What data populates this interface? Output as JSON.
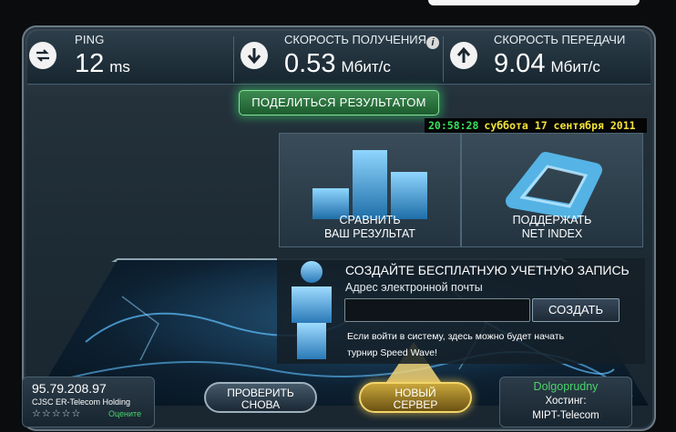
{
  "stats": {
    "ping": {
      "label": "PING",
      "value": "12",
      "unit": "ms"
    },
    "download": {
      "label": "СКОРОСТЬ ПОЛУЧЕНИЯ",
      "value": "0.53",
      "unit": "Мбит/с"
    },
    "upload": {
      "label": "СКОРОСТЬ ПЕРЕДАЧИ",
      "value": "9.04",
      "unit": "Мбит/с"
    }
  },
  "share_button": "ПОДЕЛИТЬСЯ РЕЗУЛЬТАТОМ",
  "clock": {
    "time": "20:58:28",
    "date": "суббота 17 сентября 2011"
  },
  "promos": [
    {
      "line1": "СРАВНИТЬ",
      "line2": "ВАШ РЕЗУЛЬТАТ"
    },
    {
      "line1": "ПОДДЕРЖАТЬ",
      "line2": "NET INDEX"
    }
  ],
  "signup": {
    "title": "СОЗДАЙТЕ БЕСПЛАТНУЮ УЧЕТНУЮ ЗАПИСЬ",
    "email_label": "Адрес электронной почты",
    "email_value": "",
    "create_button": "СОЗДАТЬ",
    "note_line1": "Если войти в систему, здесь можно будет начать",
    "note_line2": "турнир Speed Wave!"
  },
  "isp": {
    "ip": "95.79.208.97",
    "org": "CJSC ER-Telecom Holding",
    "stars": "☆☆☆☆☆",
    "rate_label": "Оцените"
  },
  "buttons": {
    "retry_line1": "ПРОВЕРИТЬ",
    "retry_line2": "СНОВА",
    "newserver_line1": "НОВЫЙ",
    "newserver_line2": "СЕРВЕР"
  },
  "host": {
    "city": "Dolgoprudny",
    "label": "Хостинг:",
    "name": "MIPT-Telecom"
  },
  "colors": {
    "accent_green": "#49d46b",
    "clock_time": "#36e05a",
    "clock_date": "#f2e23a"
  },
  "icons": [
    "ping-icon",
    "download-arrow-icon",
    "upload-arrow-icon",
    "info-icon",
    "bar-chart-icon",
    "net-index-logo-icon",
    "person-icon",
    "star-icon"
  ]
}
